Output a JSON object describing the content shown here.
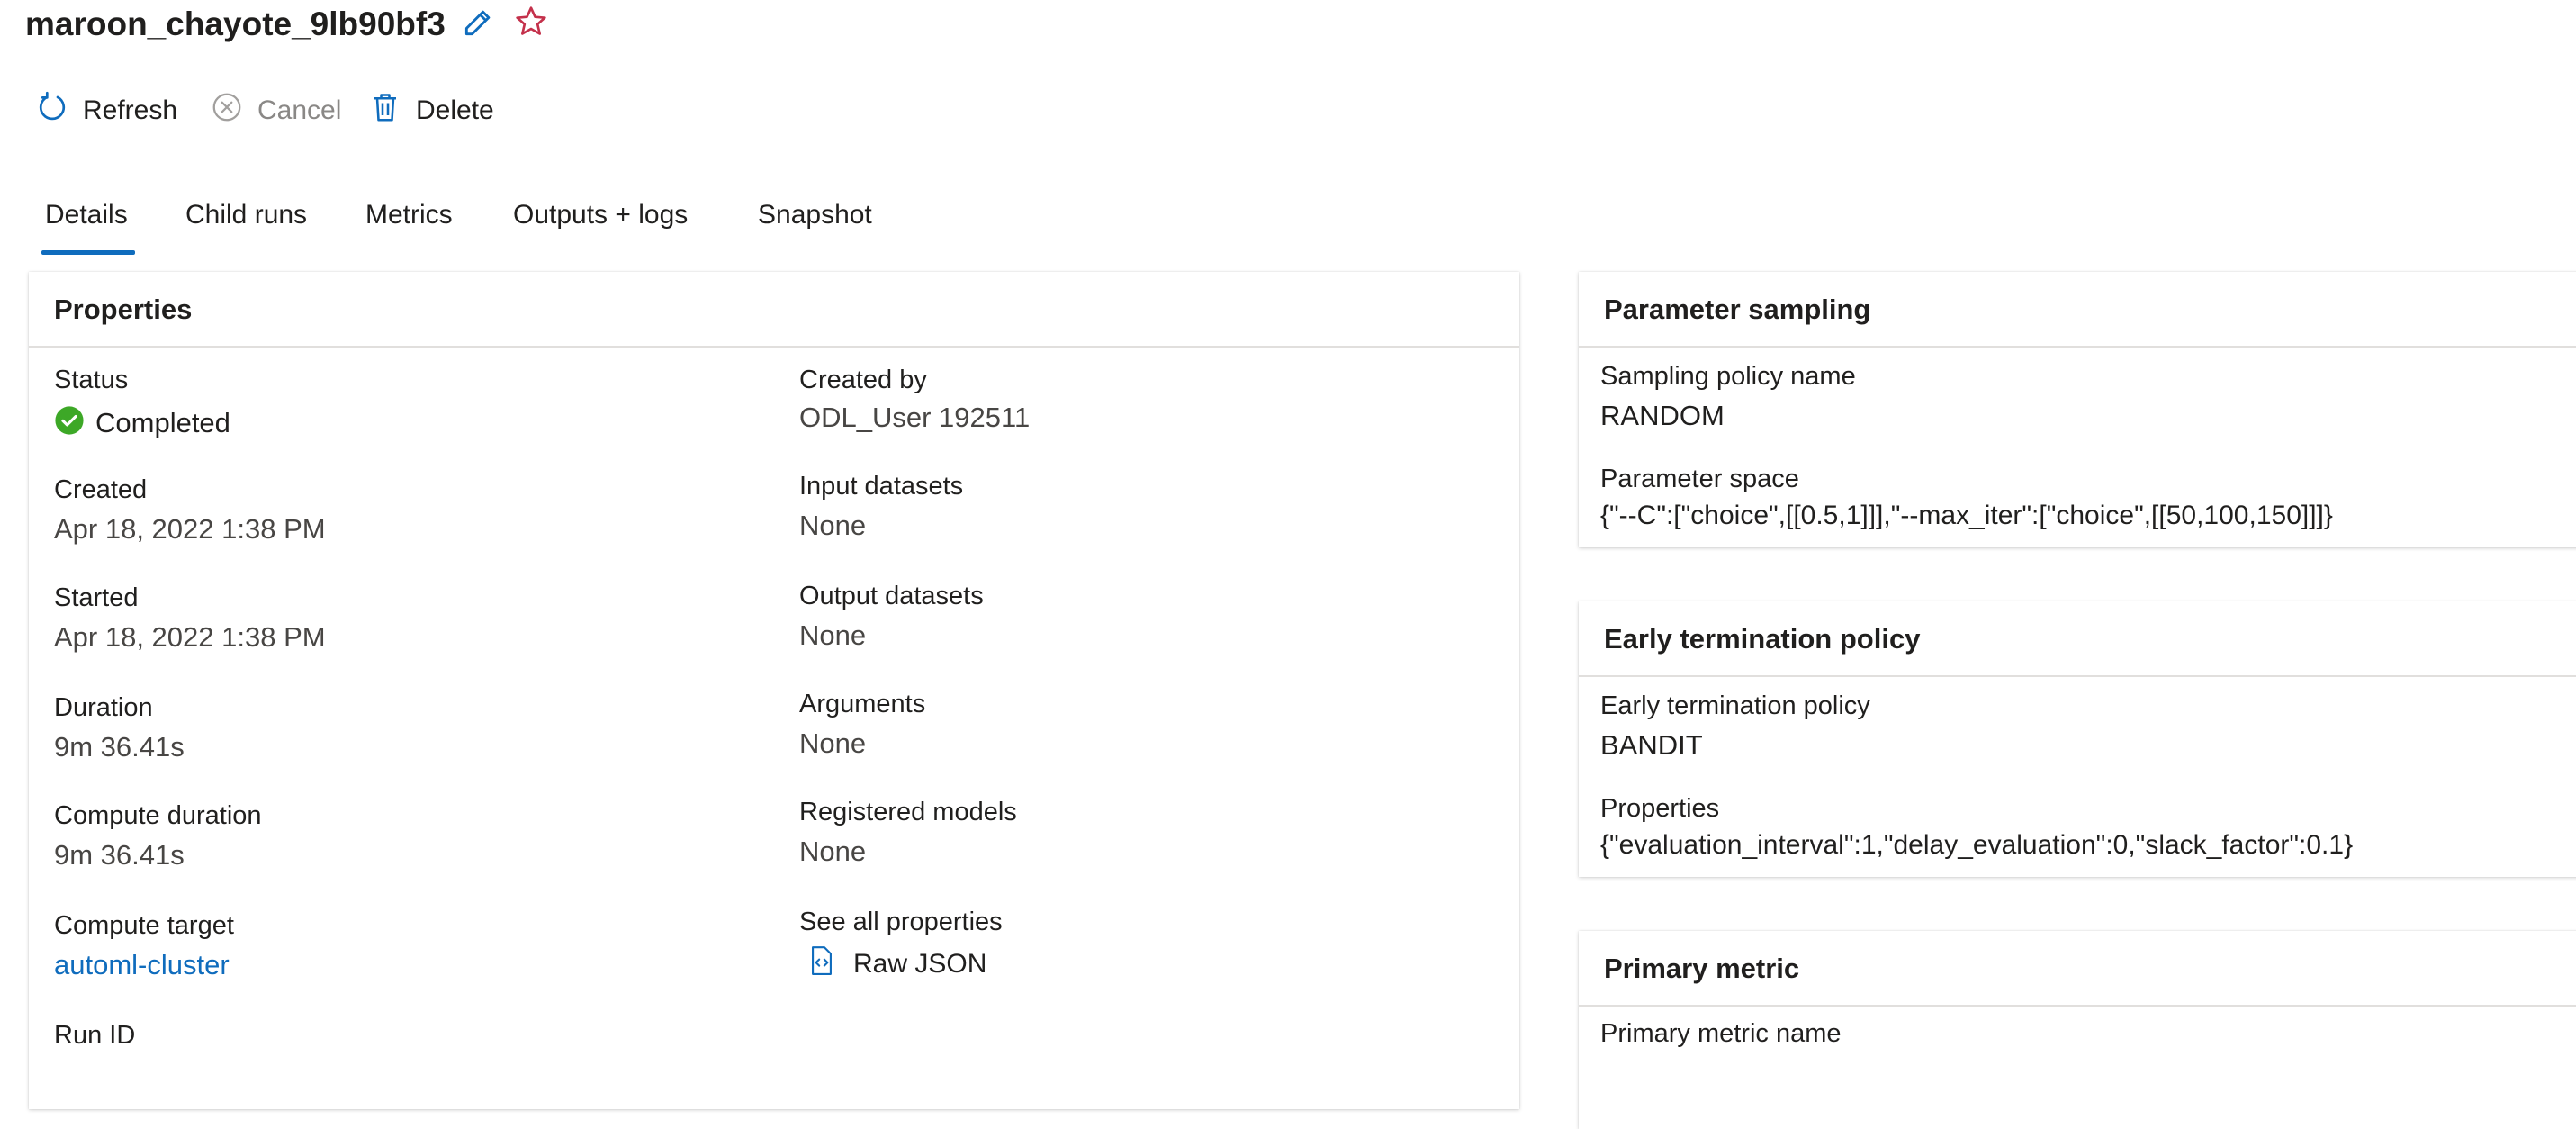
{
  "header": {
    "run_name": "maroon_chayote_9lb90bf3"
  },
  "toolbar": {
    "refresh_label": "Refresh",
    "cancel_label": "Cancel",
    "delete_label": "Delete"
  },
  "tabs": [
    {
      "label": "Details",
      "selected": true
    },
    {
      "label": "Child runs"
    },
    {
      "label": "Metrics"
    },
    {
      "label": "Outputs + logs"
    },
    {
      "label": "Snapshot"
    }
  ],
  "properties": {
    "title": "Properties",
    "status_label": "Status",
    "status_value": "Completed",
    "created_label": "Created",
    "created_value": "Apr 18, 2022 1:38 PM",
    "started_label": "Started",
    "started_value": "Apr 18, 2022 1:38 PM",
    "duration_label": "Duration",
    "duration_value": "9m 36.41s",
    "compute_duration_label": "Compute duration",
    "compute_duration_value": "9m 36.41s",
    "compute_target_label": "Compute target",
    "compute_target_value": "automl-cluster",
    "run_id_label": "Run ID",
    "created_by_label": "Created by",
    "created_by_value": "ODL_User 192511",
    "input_datasets_label": "Input datasets",
    "input_datasets_value": "None",
    "output_datasets_label": "Output datasets",
    "output_datasets_value": "None",
    "arguments_label": "Arguments",
    "arguments_value": "None",
    "registered_models_label": "Registered models",
    "registered_models_value": "None",
    "see_all_label": "See all properties",
    "raw_json_label": "Raw JSON"
  },
  "parameter_sampling": {
    "title": "Parameter sampling",
    "policy_name_label": "Sampling policy name",
    "policy_name_value": "RANDOM",
    "space_label": "Parameter space",
    "space_value": "{\"--C\":[\"choice\",[[0.5,1]]],\"--max_iter\":[\"choice\",[[50,100,150]]]}"
  },
  "early_termination": {
    "title": "Early termination policy",
    "policy_label": "Early termination policy",
    "policy_value": "BANDIT",
    "properties_label": "Properties",
    "properties_value": "{\"evaluation_interval\":1,\"delay_evaluation\":0,\"slack_factor\":0.1}"
  },
  "primary_metric": {
    "title": "Primary metric",
    "name_label": "Primary metric name"
  },
  "colors": {
    "accent": "#0f6cbd",
    "success": "#3da827",
    "star": "#c4314b",
    "muted": "#8a8886"
  },
  "icons": {
    "edit": "pencil-icon",
    "favorite": "star-icon",
    "refresh": "refresh-icon",
    "cancel": "cancel-circle-icon",
    "delete": "trash-icon",
    "status": "check-circle-icon",
    "raw_json": "code-file-icon"
  }
}
